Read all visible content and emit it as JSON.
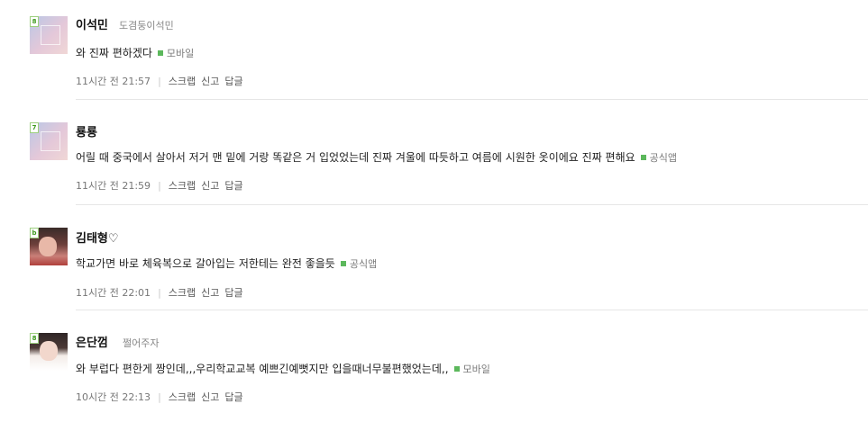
{
  "comments": [
    {
      "author": "이석민",
      "nickname": "도겸둥이석민",
      "level": "8",
      "text": "와 진짜 편하겠다",
      "source": "모바일",
      "time": "11시간 전 21:57",
      "actions": [
        "스크랩",
        "신고",
        "답글"
      ]
    },
    {
      "author": "룡룡",
      "nickname": "",
      "level": "7",
      "text": "어릴 때 중국에서 살아서 저거 맨 밑에 거랑 똑같은 거 입었었는데 진짜 겨울에 따듯하고 여름에 시원한 옷이에요 진짜 편해요",
      "source": "공식앱",
      "time": "11시간 전 21:59",
      "actions": [
        "스크랩",
        "신고",
        "답글"
      ]
    },
    {
      "author": "김태형♡",
      "nickname": "",
      "level": "b",
      "text": "학교가면 바로 체육복으로 갈아입는 저한테는 완전 좋을듯",
      "source": "공식앱",
      "time": "11시간 전 22:01",
      "actions": [
        "스크랩",
        "신고",
        "답글"
      ]
    },
    {
      "author": "은단껌",
      "nickname": "쩔어주자",
      "level": "8",
      "text": "와 부럽다 편한게 짱인데,,,우리학교교복 예쁘긴예뻣지만 입을때너무불편했었는데,,",
      "source": "모바일",
      "time": "10시간 전 22:13",
      "actions": [
        "스크랩",
        "신고",
        "답글"
      ]
    }
  ]
}
